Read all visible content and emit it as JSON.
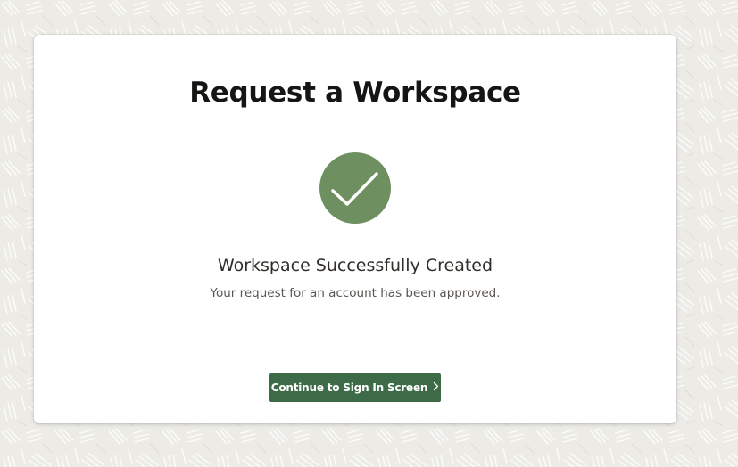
{
  "page": {
    "title": "Request a Workspace",
    "status_icon": "checkmark-icon",
    "success_heading": "Workspace Successfully Created",
    "success_message": "Your request for an account has been approved.",
    "continue_button": {
      "label": "Continue to Sign In Screen",
      "icon": "chevron-right-icon"
    }
  },
  "colors": {
    "background": "#ecebe6",
    "card": "#ffffff",
    "success_green": "#6e8f5f",
    "button_green": "#3e6b47",
    "title_text": "#161513"
  }
}
